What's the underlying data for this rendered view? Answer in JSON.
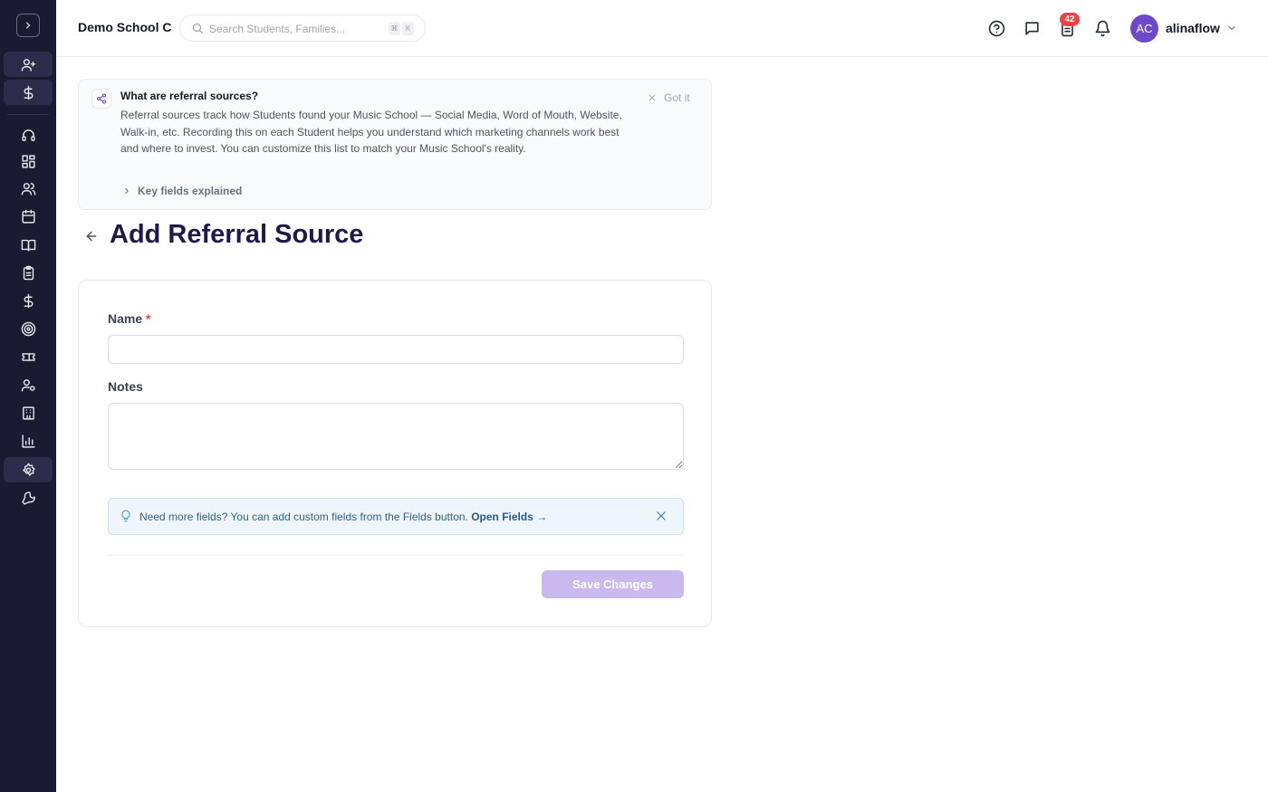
{
  "header": {
    "school_name": "Demo School C",
    "search_placeholder": "Search Students, Families...",
    "shortcut_keys": [
      "⌘",
      "K"
    ],
    "notification_count": "42",
    "user_initials": "AC",
    "username": "alinaflow"
  },
  "sidebar": {
    "items": [
      {
        "icon": "add-user-icon"
      },
      {
        "icon": "dollar-icon"
      },
      {
        "icon": "headset-icon"
      },
      {
        "icon": "dashboard-icon"
      },
      {
        "icon": "users-icon"
      },
      {
        "icon": "calendar-icon"
      },
      {
        "icon": "book-icon"
      },
      {
        "icon": "clipboard-icon"
      },
      {
        "icon": "dollar-icon"
      },
      {
        "icon": "target-icon"
      },
      {
        "icon": "ticket-icon"
      },
      {
        "icon": "user-settings-icon"
      },
      {
        "icon": "building-icon"
      },
      {
        "icon": "bar-chart-icon"
      },
      {
        "icon": "gear-icon",
        "active": true
      },
      {
        "icon": "wrench-icon"
      }
    ]
  },
  "info": {
    "title": "What are referral sources?",
    "body": "Referral sources track how Students found your Music School — Social Media, Word of Mouth, Website, Walk-in, etc. Recording this on each Student helps you understand which marketing channels work best and where to invest. You can customize this list to match your Music School's reality.",
    "dismiss": "Got it",
    "toggle": "Key fields explained"
  },
  "page": {
    "title": "Add Referral Source"
  },
  "form": {
    "name_label": "Name",
    "required_mark": "*",
    "name_value": "",
    "notes_label": "Notes",
    "notes_value": "",
    "tip_text": "Need more fields? You can add custom fields from the Fields button.",
    "tip_link": "Open Fields →",
    "save_label": "Save Changes"
  },
  "colors": {
    "sidebar_bg": "#1b1a33",
    "accent": "#6d49c9",
    "save_disabled": "#c9b9ee",
    "badge": "#ef4444",
    "title": "#1e1b4b"
  }
}
